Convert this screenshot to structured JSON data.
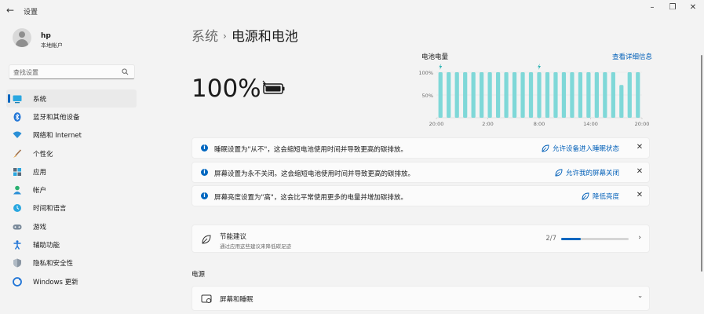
{
  "window": {
    "title": "设置",
    "back_glyph": "←",
    "minimize_glyph": "–",
    "maximize_glyph": "❐",
    "close_glyph": "✕"
  },
  "profile": {
    "name": "hp",
    "account_type": "本地帐户"
  },
  "search": {
    "placeholder": "查找设置"
  },
  "sidebar": {
    "items": [
      {
        "label": "系统",
        "icon": "monitor-icon",
        "active": true
      },
      {
        "label": "蓝牙和其他设备",
        "icon": "bluetooth-icon"
      },
      {
        "label": "网络和 Internet",
        "icon": "wifi-icon"
      },
      {
        "label": "个性化",
        "icon": "brush-icon"
      },
      {
        "label": "应用",
        "icon": "apps-icon"
      },
      {
        "label": "帐户",
        "icon": "person-icon"
      },
      {
        "label": "时间和语言",
        "icon": "globe-clock-icon"
      },
      {
        "label": "游戏",
        "icon": "gamepad-icon"
      },
      {
        "label": "辅助功能",
        "icon": "accessibility-icon"
      },
      {
        "label": "隐私和安全性",
        "icon": "shield-icon"
      },
      {
        "label": "Windows 更新",
        "icon": "update-icon"
      }
    ]
  },
  "breadcrumb": {
    "parent": "系统",
    "separator": "›",
    "current": "电源和电池"
  },
  "battery": {
    "percent_text": "100%",
    "charging": true
  },
  "chart_data": {
    "type": "bar",
    "title": "电池电量",
    "link": "查看详细信息",
    "y_ticks": [
      "100%",
      "50%"
    ],
    "ylim": [
      0,
      100
    ],
    "x_ticks": [
      "20:00",
      "2:00",
      "8:00",
      "14:00",
      "20:00"
    ],
    "values": [
      100,
      100,
      100,
      100,
      100,
      100,
      100,
      100,
      100,
      100,
      100,
      100,
      100,
      100,
      100,
      100,
      100,
      100,
      100,
      100,
      100,
      100,
      72,
      100,
      100
    ],
    "charging_markers_at": [
      0,
      12
    ],
    "color": "#7fd8d8"
  },
  "notices": [
    {
      "text": "睡眠设置为\"从不\"，这会缩短电池使用时间并导致更高的碳排放。",
      "action": "允许设备进入睡眠状态"
    },
    {
      "text": "屏幕设置为永不关闭。这会缩短电池使用时间并导致更高的碳排放。",
      "action": "允许我的屏幕关闭"
    },
    {
      "text": "屏幕亮度设置为\"高\"，这会比平常使用更多的电量并增加碳排放。",
      "action": "降低亮度"
    }
  ],
  "energy_card": {
    "title": "节能建议",
    "subtitle": "通过应用这些建议来降低碳足迹",
    "progress_text": "2/7",
    "progress_fraction": 0.2857
  },
  "power_section": {
    "label": "电源",
    "screen_sleep": {
      "title": "屏幕和睡眠"
    }
  },
  "colors": {
    "accent": "#0067c0",
    "link": "#005fb8",
    "chart": "#7fd8d8"
  }
}
